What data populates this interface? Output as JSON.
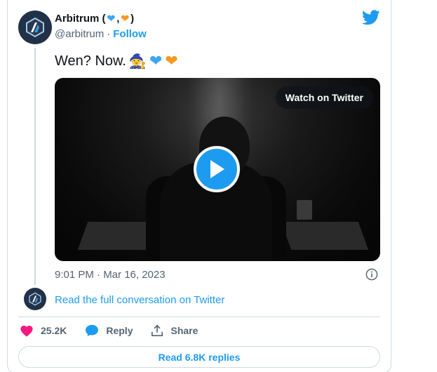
{
  "tweet": {
    "author_name": "Arbitrum (",
    "author_name_separator": ",",
    "author_name_close": ")",
    "handle": "@arbitrum",
    "separator": "·",
    "follow_label": "Follow",
    "text": "Wen? Now.",
    "text_emojis": [
      "🧙",
      "💙",
      "🧡"
    ],
    "watch_label": "Watch on Twitter",
    "timestamp": "9:01 PM · Mar 16, 2023",
    "read_full_label": "Read the full conversation on Twitter",
    "likes_count": "25.2K",
    "reply_label": "Reply",
    "share_label": "Share",
    "read_replies_label": "Read 6.8K replies"
  },
  "colors": {
    "twitter_blue": "#1d9bf0",
    "like_pink": "#f91880",
    "avatar_bg": "#213147",
    "heart_blue": "#3ea6f2",
    "heart_orange": "#f49a22"
  },
  "icons": {
    "logo": "twitter-bird-icon",
    "info": "info-icon",
    "like": "heart-icon",
    "reply": "speech-bubble-icon",
    "share": "share-upload-icon",
    "play": "play-icon"
  }
}
